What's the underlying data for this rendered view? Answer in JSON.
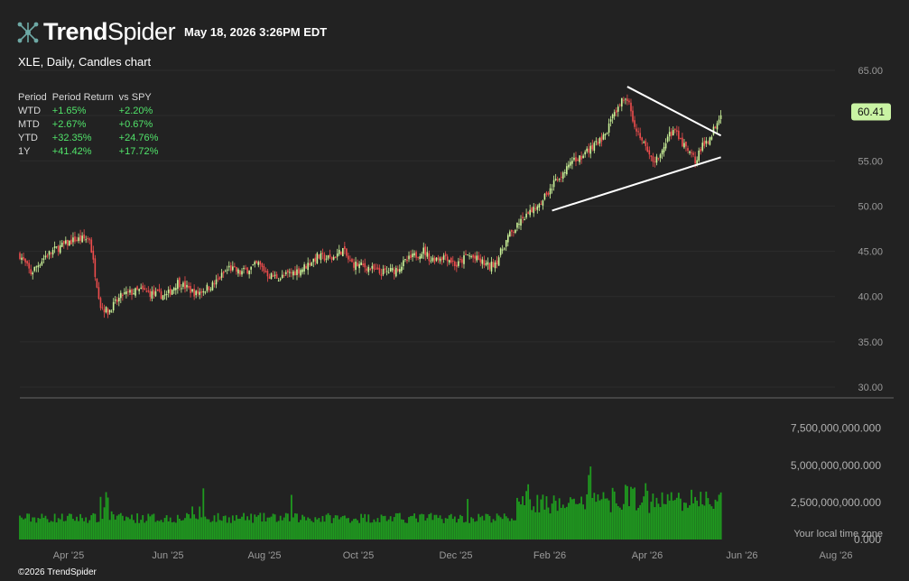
{
  "header": {
    "brand_bold": "Trend",
    "brand_light": "Spider",
    "datetime": "May 18, 2026 3:26PM EDT",
    "chart_title": "XLE, Daily, Candles chart",
    "copyright": "©2026 TrendSpider"
  },
  "performance": {
    "headers": [
      "Period",
      "Period Return",
      "vs SPY"
    ],
    "rows": [
      {
        "period": "WTD",
        "ret": "+1.65%",
        "vs": "+2.20%"
      },
      {
        "period": "MTD",
        "ret": "+2.67%",
        "vs": "+0.67%"
      },
      {
        "period": "YTD",
        "ret": "+32.35%",
        "vs": "+24.76%"
      },
      {
        "period": "1Y",
        "ret": "+41.42%",
        "vs": "+17.72%"
      }
    ]
  },
  "colors": {
    "background": "#222222",
    "up": "#cdf59a",
    "down": "#ef4d4d",
    "volume": "#1f9b1f",
    "trendline": "#ffffff",
    "positive_text": "#51e36a",
    "price_badge": "#c9f3a3"
  },
  "chart_data": {
    "type": "candlestick",
    "symbol": "XLE",
    "interval": "Daily",
    "last_price": "60.41",
    "x_ticks": [
      "Apr '25",
      "Jun '25",
      "Aug '25",
      "Oct '25",
      "Dec '25",
      "Feb '26",
      "Apr '26",
      "Jun '26",
      "Aug '26"
    ],
    "y_ticks": [
      "65.00",
      "60.00",
      "55.00",
      "50.00",
      "45.00",
      "40.00",
      "35.00",
      "30.00"
    ],
    "ylim": [
      30,
      65
    ],
    "close_path": [
      [
        0,
        44.6
      ],
      [
        6,
        42.6
      ],
      [
        14,
        44.5
      ],
      [
        20,
        45.3
      ],
      [
        30,
        46.3
      ],
      [
        38,
        46.4
      ],
      [
        40,
        43.8
      ],
      [
        44,
        39.0
      ],
      [
        48,
        38.3
      ],
      [
        56,
        40.2
      ],
      [
        66,
        40.7
      ],
      [
        72,
        40.3
      ],
      [
        80,
        40.1
      ],
      [
        86,
        41.6
      ],
      [
        96,
        40.3
      ],
      [
        106,
        41.4
      ],
      [
        114,
        43.2
      ],
      [
        120,
        42.6
      ],
      [
        130,
        43.6
      ],
      [
        136,
        42.3
      ],
      [
        142,
        42.1
      ],
      [
        154,
        43.1
      ],
      [
        162,
        44.4
      ],
      [
        170,
        44.2
      ],
      [
        176,
        45.2
      ],
      [
        180,
        43.7
      ],
      [
        190,
        43.2
      ],
      [
        196,
        42.6
      ],
      [
        204,
        42.9
      ],
      [
        212,
        44.1
      ],
      [
        220,
        45.1
      ],
      [
        224,
        44.1
      ],
      [
        232,
        44.5
      ],
      [
        238,
        43.4
      ],
      [
        244,
        44.6
      ],
      [
        250,
        44.0
      ],
      [
        256,
        43.3
      ],
      [
        260,
        44.0
      ],
      [
        266,
        46.6
      ],
      [
        274,
        48.4
      ],
      [
        282,
        50.2
      ],
      [
        288,
        51.6
      ],
      [
        294,
        53.3
      ],
      [
        300,
        54.6
      ],
      [
        310,
        56.2
      ],
      [
        318,
        57.6
      ],
      [
        324,
        60.1
      ],
      [
        328,
        61.6
      ],
      [
        332,
        61.9
      ],
      [
        334,
        59.7
      ],
      [
        338,
        57.6
      ],
      [
        342,
        56.1
      ],
      [
        346,
        55.1
      ],
      [
        350,
        56.2
      ],
      [
        356,
        58.6
      ],
      [
        360,
        57.1
      ],
      [
        364,
        56.1
      ],
      [
        368,
        55.1
      ],
      [
        372,
        56.6
      ],
      [
        376,
        57.6
      ],
      [
        380,
        59.4
      ],
      [
        382,
        60.41
      ]
    ],
    "volume_ticks": [
      "7,500,000,000.000",
      "5,000,000,000.000",
      "2,500,000,000.000",
      "0.000"
    ],
    "volume_max": 8700000000,
    "trendlines": [
      {
        "from": [
          331,
          63.2
        ],
        "to": [
          382,
          57.8
        ]
      },
      {
        "from": [
          290,
          49.5
        ],
        "to": [
          382,
          55.4
        ]
      }
    ],
    "timezone_note": "Your local time zone"
  }
}
